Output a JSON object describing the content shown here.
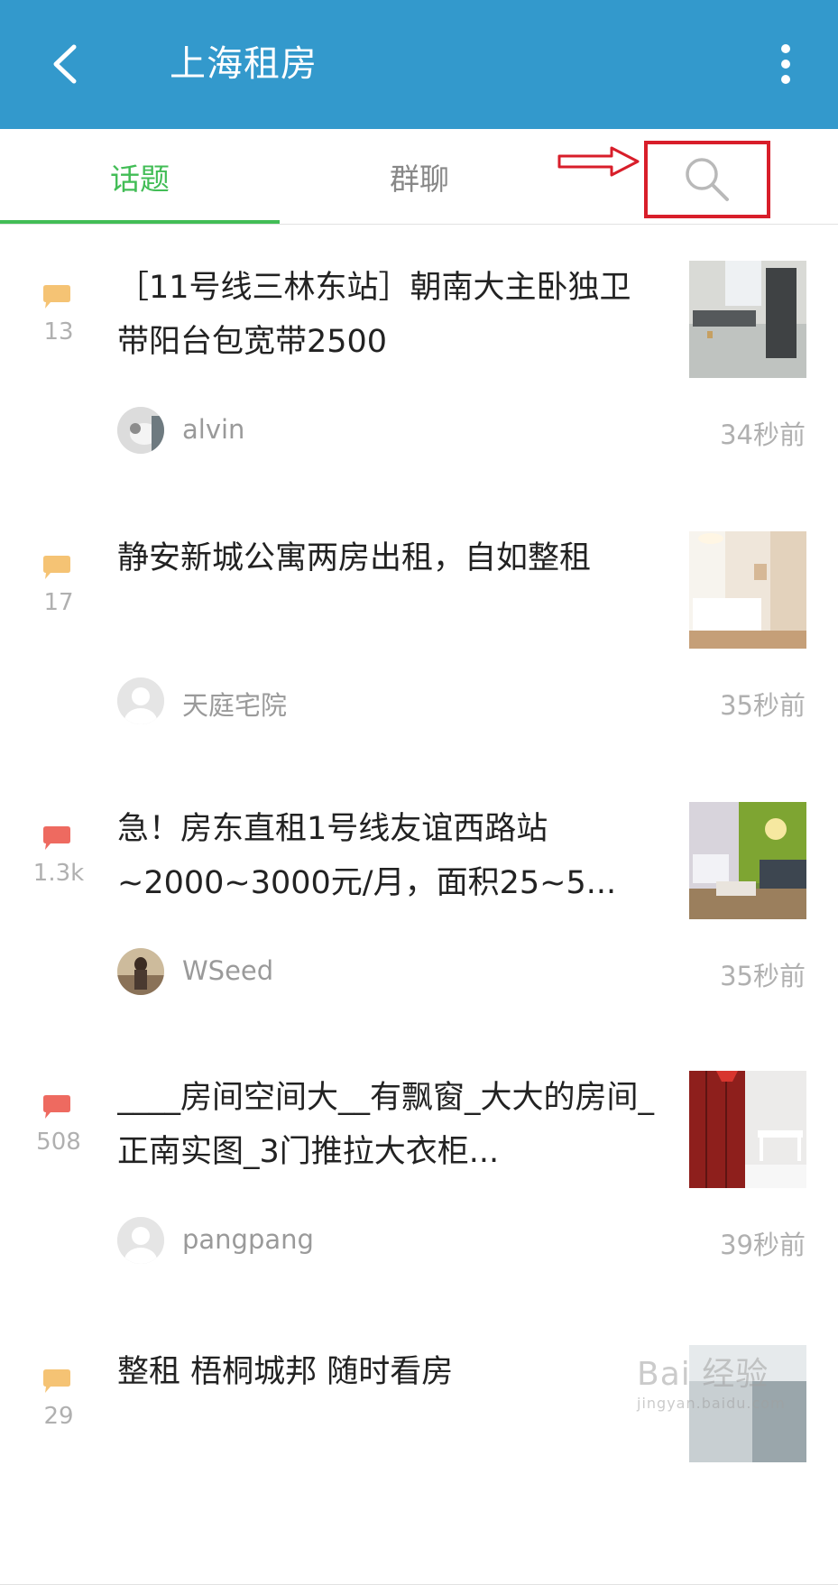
{
  "header": {
    "title": "上海租房",
    "back_icon": "back-arrow-icon",
    "more_icon": "more-vert-icon",
    "color": "#3399cc"
  },
  "tabs": [
    {
      "label": "话题",
      "active": true
    },
    {
      "label": "群聊",
      "active": false
    }
  ],
  "search": {
    "icon": "search-icon"
  },
  "accent_color": "#42bd56",
  "annotation_color": "#d81e2a",
  "topics": [
    {
      "title": "［11号线三林东站］朝南大主卧独卫带阳台包宽带2500",
      "replies": "13",
      "author": "alvin",
      "time": "34秒前",
      "bubble_color": "#f5c374"
    },
    {
      "title": "静安新城公寓两房出租，自如整租",
      "replies": "17",
      "author": "天庭宅院",
      "time": "35秒前",
      "bubble_color": "#f5c374"
    },
    {
      "title": "急！房东直租1号线友谊西路站~2000~3000元/月，面积25~5...",
      "replies": "1.3k",
      "author": "WSeed",
      "time": "35秒前",
      "bubble_color": "#ee6a60"
    },
    {
      "title": "____房间空间大__有飘窗_大大的房间_正南实图_3门推拉大衣柜...",
      "replies": "508",
      "author": "pangpang",
      "time": "39秒前",
      "bubble_color": "#ee6a60"
    },
    {
      "title": "整租 梧桐城邦 随时看房",
      "replies": "29",
      "author": "",
      "time": "",
      "bubble_color": "#f5c374"
    }
  ],
  "watermark": {
    "text": "Bai 经验",
    "sub": "jingyan.baidu.com"
  }
}
